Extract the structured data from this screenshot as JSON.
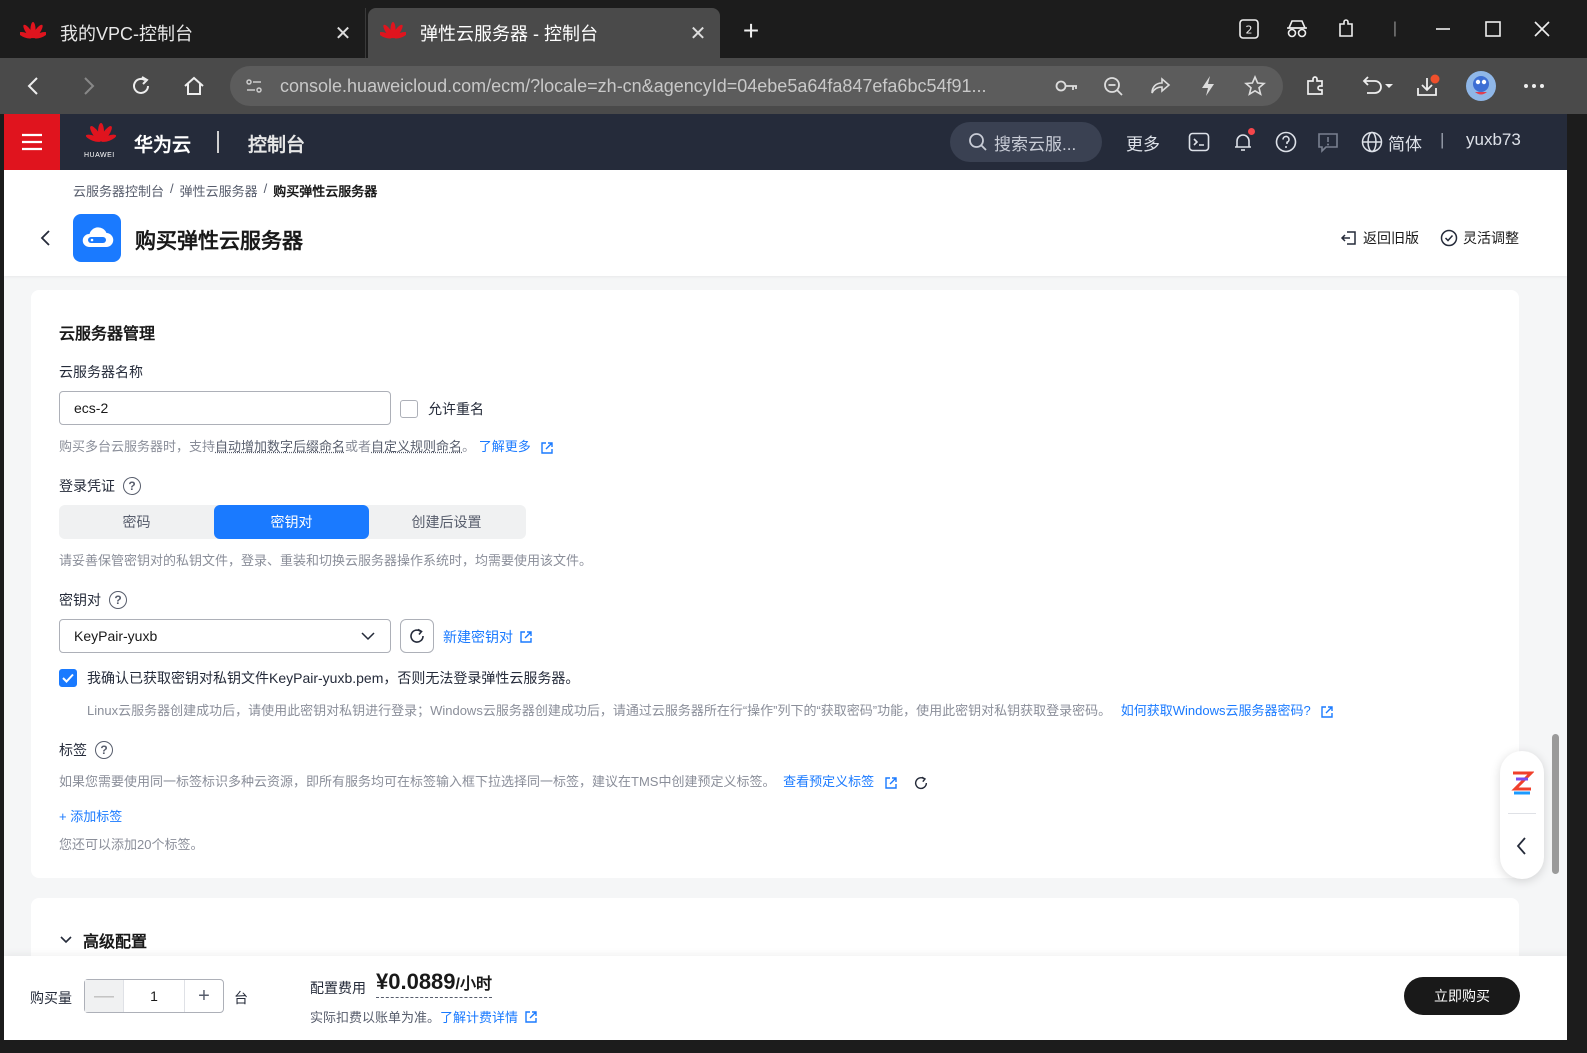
{
  "browser": {
    "tabs": [
      {
        "title": "我的VPC-控制台",
        "active": false
      },
      {
        "title": "弹性云服务器 - 控制台",
        "active": true
      }
    ],
    "url": "console.huaweicloud.com/ecm/?locale=zh-cn&agencyId=04ebe5a64fa847efa6bc54f91..."
  },
  "header": {
    "brand": "华为云",
    "console": "控制台",
    "logo_text": "HUAWEI",
    "search_placeholder": "搜索云服...",
    "more": "更多",
    "language": "简体",
    "user": "yuxb73"
  },
  "page": {
    "breadcrumb": [
      "云服务器控制台",
      "弹性云服务器",
      "购买弹性云服务器"
    ],
    "title": "购买弹性云服务器",
    "actions": {
      "old_version": "返回旧版",
      "flexible": "灵活调整"
    }
  },
  "management": {
    "section_title": "云服务器管理",
    "name_label": "云服务器名称",
    "name_value": "ecs-2",
    "allow_dup_label": "允许重名",
    "name_hint": {
      "prefix": "购买多台云服务器时，支持",
      "auto": "自动增加数字后缀命名",
      "or": "或者",
      "custom": "自定义规则命名",
      "suffix": "。",
      "learn_more": "了解更多"
    },
    "login_label": "登录凭证",
    "login_options": [
      "密码",
      "密钥对",
      "创建后设置"
    ],
    "login_selected": "密钥对",
    "login_hint": "请妥善保管密钥对的私钥文件，登录、重装和切换云服务器操作系统时，均需要使用该文件。",
    "keypair_label": "密钥对",
    "keypair_value": "KeyPair-yuxb",
    "new_keypair": "新建密钥对",
    "confirm_text": "我确认已获取密钥对私钥文件KeyPair-yuxb.pem，否则无法登录弹性云服务器。",
    "confirm_checked": true,
    "keypair_hint": "Linux云服务器创建成功后，请使用此密钥对私钥进行登录；Windows云服务器创建成功后，请通过云服务器所在行“操作”列下的“获取密码”功能，使用此密钥对私钥获取登录密码。",
    "windows_pwd_link": "如何获取Windows云服务器密码?",
    "tag_label": "标签",
    "tag_hint": "如果您需要使用同一标签标识多种云资源，即所有服务均可在标签输入框下拉选择同一标签，建议在TMS中创建预定义标签。",
    "view_tags": "查看预定义标签",
    "add_tag": "+ 添加标签",
    "tag_remaining": "您还可以添加20个标签。"
  },
  "advanced": {
    "title": "高级配置"
  },
  "footer": {
    "qty_label": "购买量",
    "qty_value": "1",
    "qty_unit": "台",
    "fee_label": "配置费用",
    "price": "¥0.0889",
    "price_unit": "/小时",
    "fee_note": "实际扣费以账单为准。",
    "fee_link": "了解计费详情",
    "buy_button": "立即购买"
  },
  "colors": {
    "accent": "#1a7aff",
    "brand_red": "#e0141e",
    "header_bg": "#252b3a"
  }
}
